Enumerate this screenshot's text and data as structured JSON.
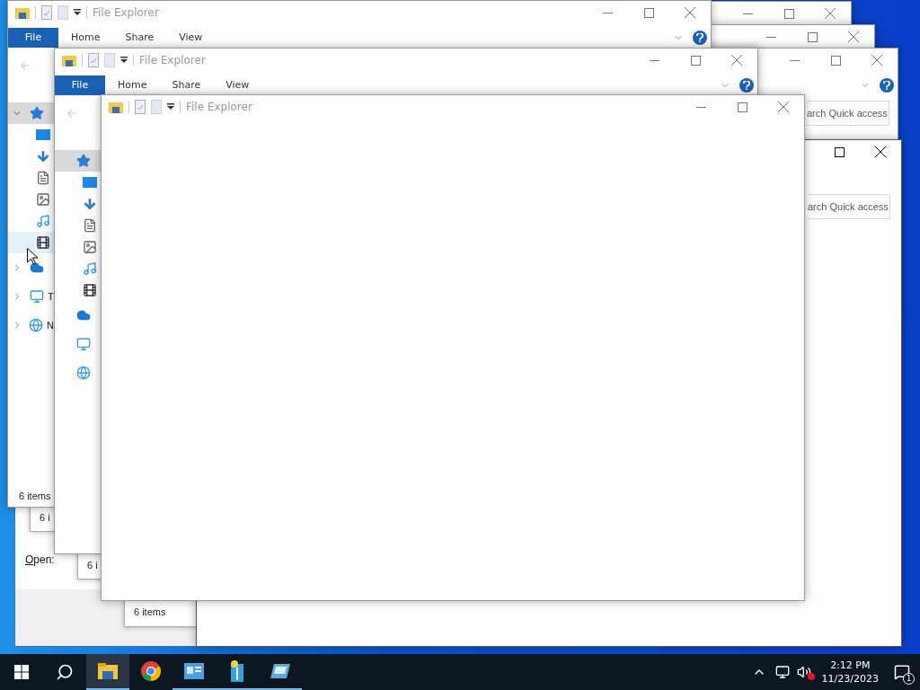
{
  "windows": [
    {
      "kind": "explorer",
      "title": "File Explorer",
      "minimize": true,
      "ribbon": {
        "help": true,
        "tabs": [
          {
            "label": "File",
            "selected": true
          },
          {
            "label": "Home",
            "selected": false
          },
          {
            "label": "Share",
            "selected": false
          },
          {
            "label": "View",
            "selected": false
          }
        ]
      },
      "nav": [
        {
          "kind": "quick_access",
          "selected": true,
          "expanded": true,
          "children": [
            {
              "kind": "desktop",
              "selected": false,
              "hovered": false
            },
            {
              "kind": "downloads",
              "selected": false,
              "hovered": false
            },
            {
              "kind": "documents",
              "selected": false,
              "hovered": false
            },
            {
              "kind": "pictures",
              "selected": false,
              "hovered": false
            },
            {
              "kind": "music",
              "selected": false,
              "hovered": false
            },
            {
              "kind": "videos",
              "selected": false,
              "hovered": true
            }
          ]
        },
        {
          "kind": "onedrive",
          "selected": false,
          "expanded": false
        },
        {
          "kind": "this_pc",
          "selected": false,
          "expanded": false,
          "label": "T"
        },
        {
          "kind": "network",
          "selected": false,
          "expanded": false,
          "label": "N"
        }
      ],
      "status": "6 items"
    },
    {
      "kind": "explorer",
      "minimize": true
    },
    {
      "kind": "explorer",
      "minimize": true
    },
    {
      "kind": "explorer",
      "title": "File Explorer",
      "minimize": true,
      "ribbon": {
        "help": true,
        "tabs": [
          {
            "label": "File",
            "selected": true
          },
          {
            "label": "Home",
            "selected": false
          },
          {
            "label": "Share",
            "selected": false
          },
          {
            "label": "View",
            "selected": false
          }
        ]
      },
      "nav": [
        {
          "kind": "quick_access",
          "selected": true,
          "children": [
            {
              "kind": "desktop",
              "selected": false,
              "hovered": false
            },
            {
              "kind": "downloads",
              "selected": false,
              "hovered": false
            },
            {
              "kind": "documents",
              "selected": false,
              "hovered": false
            },
            {
              "kind": "pictures",
              "selected": false,
              "hovered": false
            },
            {
              "kind": "music",
              "selected": false,
              "hovered": false
            },
            {
              "kind": "videos",
              "selected": false,
              "hovered": false
            }
          ]
        },
        {
          "kind": "onedrive",
          "selected": false
        },
        {
          "kind": "this_pc",
          "selected": false
        },
        {
          "kind": "network",
          "selected": false
        }
      ]
    },
    {
      "kind": "explorer",
      "minimize": true,
      "ribbon": {
        "help": true
      },
      "search": "arch Quick access"
    },
    {
      "kind": "explorer",
      "title": "File Explorer",
      "minimize": true
    },
    {
      "kind": "explorer",
      "active": true,
      "minimize": false,
      "search": "arch Quick access"
    },
    {
      "kind": "stub",
      "status": "6 i"
    },
    {
      "kind": "dialog",
      "open_label": "Open:"
    },
    {
      "kind": "stub",
      "status": "6 i"
    },
    {
      "kind": "stub",
      "status": "6 items"
    }
  ],
  "taskbar": {
    "apps": [
      {
        "kind": "explorer",
        "active": true,
        "running": true
      },
      {
        "kind": "chrome",
        "active": false,
        "running": false
      },
      {
        "kind": "control_panel",
        "active": false,
        "running": true
      },
      {
        "kind": "archive",
        "active": false,
        "running": true
      },
      {
        "kind": "drive",
        "active": false,
        "running": true
      }
    ],
    "time": "2:12 PM",
    "date": "11/23/2023",
    "notifications": "1"
  }
}
